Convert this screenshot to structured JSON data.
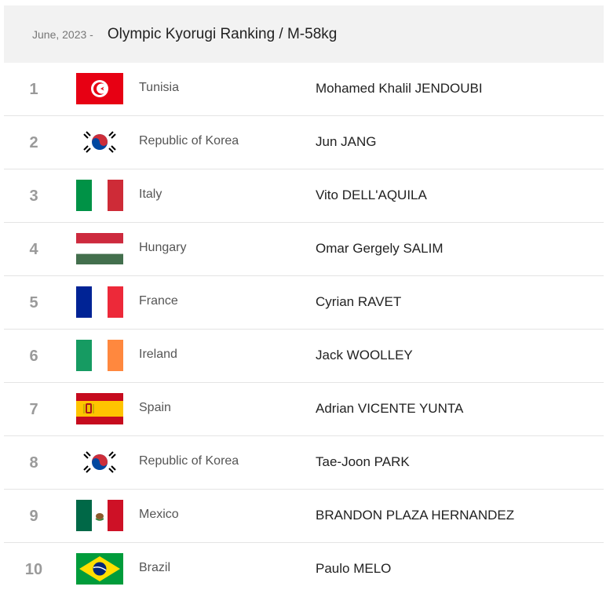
{
  "header": {
    "date": "June, 2023 -",
    "title": "Olympic Kyorugi Ranking / M-58kg"
  },
  "rows": [
    {
      "rank": "1",
      "flag": "tunisia-flag-icon",
      "country": "Tunisia",
      "athlete": "Mohamed Khalil JENDOUBI"
    },
    {
      "rank": "2",
      "flag": "korea-flag-icon",
      "country": "Republic of Korea",
      "athlete": "Jun JANG"
    },
    {
      "rank": "3",
      "flag": "italy-flag-icon",
      "country": "Italy",
      "athlete": "Vito DELL'AQUILA"
    },
    {
      "rank": "4",
      "flag": "hungary-flag-icon",
      "country": "Hungary",
      "athlete": "Omar Gergely SALIM"
    },
    {
      "rank": "5",
      "flag": "france-flag-icon",
      "country": "France",
      "athlete": "Cyrian RAVET"
    },
    {
      "rank": "6",
      "flag": "ireland-flag-icon",
      "country": "Ireland",
      "athlete": "Jack WOOLLEY"
    },
    {
      "rank": "7",
      "flag": "spain-flag-icon",
      "country": "Spain",
      "athlete": "Adrian VICENTE YUNTA"
    },
    {
      "rank": "8",
      "flag": "korea-flag-icon",
      "country": "Republic of Korea",
      "athlete": "Tae-Joon PARK"
    },
    {
      "rank": "9",
      "flag": "mexico-flag-icon",
      "country": "Mexico",
      "athlete": "BRANDON PLAZA HERNANDEZ"
    },
    {
      "rank": "10",
      "flag": "brazil-flag-icon",
      "country": "Brazil",
      "athlete": "Paulo MELO"
    }
  ]
}
